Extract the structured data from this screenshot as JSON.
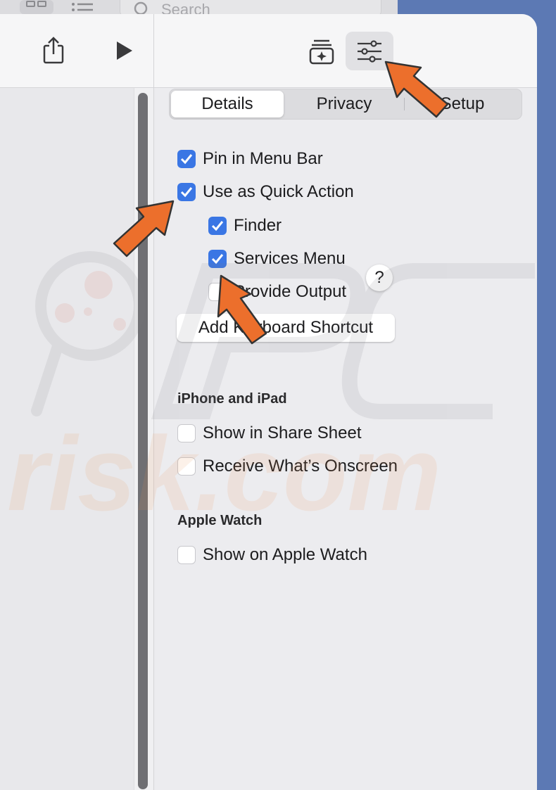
{
  "background_window": {
    "search_placeholder": "Search"
  },
  "tabs": [
    {
      "label": "Details",
      "active": true
    },
    {
      "label": "Privacy",
      "active": false
    },
    {
      "label": "Setup",
      "active": false
    }
  ],
  "options": {
    "pin_menu_bar": {
      "label": "Pin in Menu Bar",
      "checked": true
    },
    "quick_action": {
      "label": "Use as Quick Action",
      "checked": true
    },
    "finder": {
      "label": "Finder",
      "checked": true
    },
    "services_menu": {
      "label": "Services Menu",
      "checked": true
    },
    "provide_output": {
      "label": "Provide Output",
      "checked": false
    }
  },
  "help_label": "?",
  "keyboard_shortcut_label": "Add Keyboard Shortcut",
  "iphone_section": {
    "title": "iPhone and iPad",
    "share_sheet": {
      "label": "Show in Share Sheet",
      "checked": false
    },
    "onscreen": {
      "label": "Receive What’s Onscreen",
      "checked": false
    }
  },
  "watch_section": {
    "title": "Apple Watch",
    "show_watch": {
      "label": "Show on Apple Watch",
      "checked": false
    }
  },
  "watermark": {
    "text": "risk.com"
  },
  "colors": {
    "accent": "#3a76e4",
    "arrow": "#ec6f2c",
    "backdrop": "#5c79b4"
  }
}
